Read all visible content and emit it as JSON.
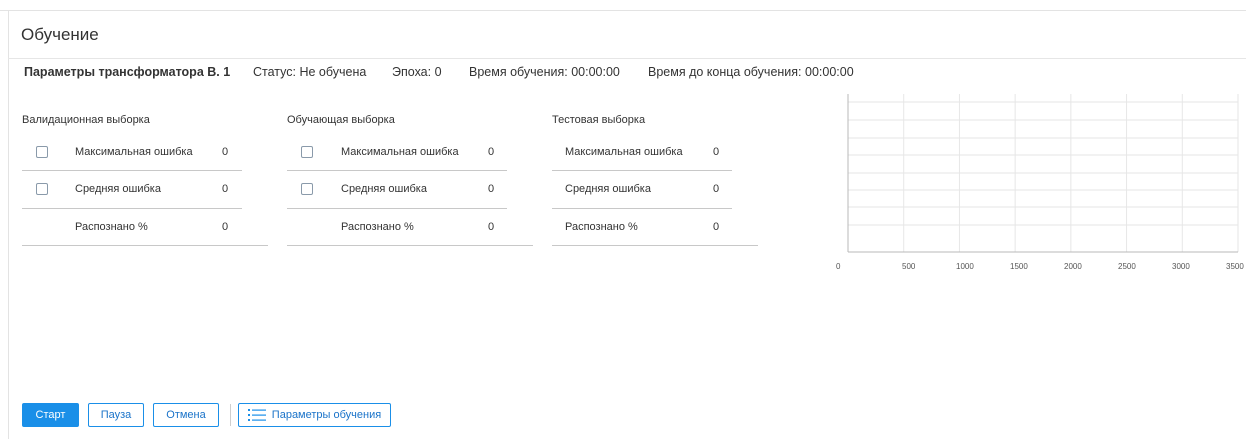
{
  "title": "Обучение",
  "info": {
    "params": "Параметры трансформатора В. 1",
    "status": "Статус: Не обучена",
    "epoch": "Эпоха: 0",
    "train_time": "Время обучения: 00:00:00",
    "time_left": "Время до конца обучения: 00:00:00"
  },
  "sections": [
    {
      "title": "Валидационная выборка",
      "rows": [
        {
          "label": "Максимальная ошибка",
          "value": "0",
          "checkbox": true,
          "checked": false
        },
        {
          "label": "Средняя ошибка",
          "value": "0",
          "checkbox": true,
          "checked": false
        },
        {
          "label": "Распознано %",
          "value": "0",
          "checkbox": false
        }
      ]
    },
    {
      "title": "Обучающая выборка",
      "rows": [
        {
          "label": "Максимальная ошибка",
          "value": "0",
          "checkbox": true,
          "checked": false
        },
        {
          "label": "Средняя ошибка",
          "value": "0",
          "checkbox": true,
          "checked": false
        },
        {
          "label": "Распознано %",
          "value": "0",
          "checkbox": false
        }
      ]
    },
    {
      "title": "Тестовая выборка",
      "rows": [
        {
          "label": "Максимальная ошибка",
          "value": "0",
          "checkbox": false
        },
        {
          "label": "Средняя ошибка",
          "value": "0",
          "checkbox": false
        },
        {
          "label": "Распознано %",
          "value": "0",
          "checkbox": false
        }
      ]
    }
  ],
  "chart_data": {
    "type": "line",
    "series": [],
    "x_ticks": [
      "0",
      "500",
      "1000",
      "1500",
      "2000",
      "2500",
      "3000",
      "3500"
    ],
    "xlim": [
      0,
      3500
    ],
    "grid": true,
    "horizontal_gridlines": 6,
    "title": "",
    "xlabel": "",
    "ylabel": ""
  },
  "buttons": {
    "start": "Старт",
    "pause": "Пауза",
    "cancel": "Отмена",
    "params": "Параметры обучения"
  },
  "colors": {
    "primary": "#1a8fe8",
    "grid": "#e6e6e6",
    "axis": "#b8b8b8"
  }
}
